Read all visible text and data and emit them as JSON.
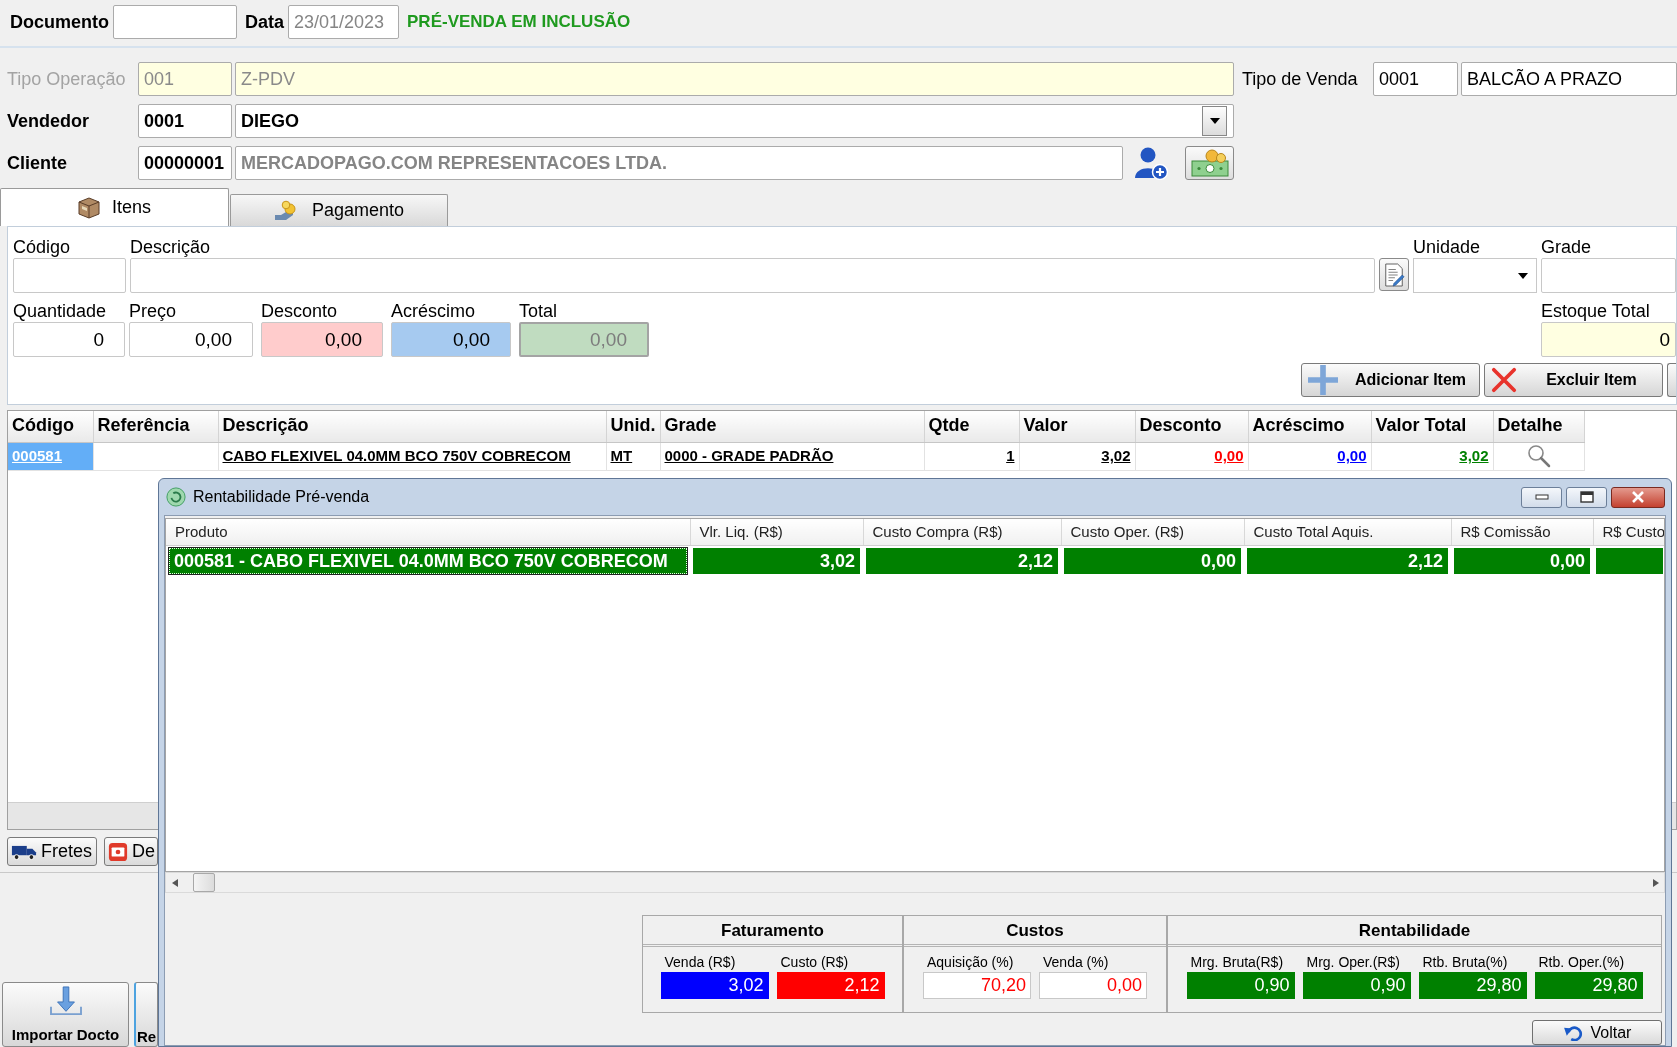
{
  "header": {
    "document": {
      "label": "Documento"
    },
    "date": {
      "label": "Data",
      "value": "23/01/2023",
      "disabled": true
    },
    "status": "PRÉ-VENDA EM INCLUSÃO"
  },
  "order": {
    "operation": {
      "label": "Tipo Operação",
      "code": "001",
      "description": "Z-PDV",
      "disabled": true
    },
    "sale_type": {
      "label": "Tipo de Venda",
      "code": "0001",
      "description": "BALCÃO A PRAZO"
    },
    "seller": {
      "label": "Vendedor",
      "code": "0001",
      "name": "DIEGO"
    },
    "customer": {
      "label": "Cliente",
      "code": "00000001",
      "name": "MERCADOPAGO.COM REPRESENTACOES LTDA."
    }
  },
  "tabs": [
    {
      "label": "Itens",
      "selected": true,
      "kind": "box"
    },
    {
      "label": "Pagamento",
      "selected": false,
      "kind": "payment"
    }
  ],
  "item_form": {
    "row_1": [
      {
        "label": "Código",
        "kind": "text"
      },
      {
        "label": "Descrição",
        "kind": "text"
      },
      {
        "label": "Unidade",
        "kind": "select"
      },
      {
        "label": "Grade",
        "kind": "text"
      }
    ],
    "row_2": [
      {
        "label": "Quantidade",
        "value": "0",
        "color": "#ffffff",
        "disabled": false
      },
      {
        "label": "Preço",
        "value": "0,00",
        "color": "#ffffff",
        "disabled": false
      },
      {
        "label": "Desconto",
        "value": "0,00",
        "color": "#ffcccc",
        "disabled": false
      },
      {
        "label": "Acréscimo",
        "value": "0,00",
        "color": "#a6caf0",
        "disabled": false
      },
      {
        "label": "Total",
        "value": "0,00",
        "color": "#c0dcc0",
        "disabled": true
      }
    ],
    "stock": {
      "label": "Estoque Total",
      "value": "0"
    },
    "buttons": [
      {
        "label": "Adicionar Item",
        "kind": "add"
      },
      {
        "label": "Excluir Item",
        "kind": "delete"
      }
    ]
  },
  "grid": {
    "columns": [
      {
        "label": "Código",
        "kind": "code"
      },
      {
        "label": "Referência",
        "kind": "text"
      },
      {
        "label": "Descrição",
        "kind": "text"
      },
      {
        "label": "Unid.",
        "kind": "text"
      },
      {
        "label": "Grade",
        "kind": "text"
      },
      {
        "label": "Qtde",
        "kind": "number"
      },
      {
        "label": "Valor",
        "kind": "number"
      },
      {
        "label": "Desconto",
        "kind": "discount"
      },
      {
        "label": "Acréscimo",
        "kind": "surcharge"
      },
      {
        "label": "Valor Total",
        "kind": "total"
      },
      {
        "label": "Detalhe",
        "kind": "detail"
      }
    ],
    "rows": [
      {
        "selected": true,
        "cells": [
          "000581",
          null,
          "CABO FLEXIVEL 04.0MM BCO 750V COBRECOM",
          "MT",
          "0000 - GRADE PADRÃO",
          "1",
          "3,02",
          "0,00",
          "0,00",
          "3,02",
          null
        ]
      }
    ]
  },
  "lower_buttons": [
    {
      "label": "Fretes",
      "kind": "truck"
    },
    {
      "label": "De",
      "kind": "money"
    }
  ],
  "bottom_buttons": [
    {
      "label": "Importar Docto",
      "kind": "import"
    },
    {
      "label": "Re",
      "kind": "plain"
    }
  ],
  "dialog": {
    "title": "Rentabilidade Pré-venda",
    "columns": [
      "Produto",
      "Vlr. Liq. (R$)",
      "Custo Compra (R$)",
      "Custo Oper. (R$)",
      "Custo Total Aquis.",
      "R$ Comissão",
      "R$ Custo"
    ],
    "rows": [
      {
        "selected": true,
        "cells": [
          "000581 - CABO FLEXIVEL 04.0MM BCO 750V COBRECOM",
          "3,02",
          "2,12",
          "0,00",
          "2,12",
          "0,00"
        ]
      }
    ],
    "summary": [
      {
        "title": "Faturamento",
        "metrics": [
          {
            "label": "Venda (R$)",
            "value": "3,02",
            "kind": "filled",
            "color": "#0000ff"
          },
          {
            "label": "Custo (R$)",
            "value": "2,12",
            "kind": "filled",
            "color": "#ff0000"
          }
        ]
      },
      {
        "title": "Custos",
        "metrics": [
          {
            "label": "Aquisição (%)",
            "value": "70,20",
            "kind": "outlined",
            "color": "#ff0000"
          },
          {
            "label": "Venda (%)",
            "value": "0,00",
            "kind": "outlined",
            "color": "#ff0000"
          }
        ]
      },
      {
        "title": "Rentabilidade",
        "metrics": [
          {
            "label": "Mrg. Bruta(R$)",
            "value": "0,90",
            "kind": "filled",
            "color": "#008000"
          },
          {
            "label": "Mrg. Oper.(R$)",
            "value": "0,90",
            "kind": "filled",
            "color": "#008000"
          },
          {
            "label": "Rtb. Bruta(%)",
            "value": "29,80",
            "kind": "filled",
            "color": "#008000"
          },
          {
            "label": "Rtb. Oper.(%)",
            "value": "29,80",
            "kind": "filled",
            "color": "#008000"
          }
        ]
      }
    ],
    "close_button": "Voltar"
  }
}
